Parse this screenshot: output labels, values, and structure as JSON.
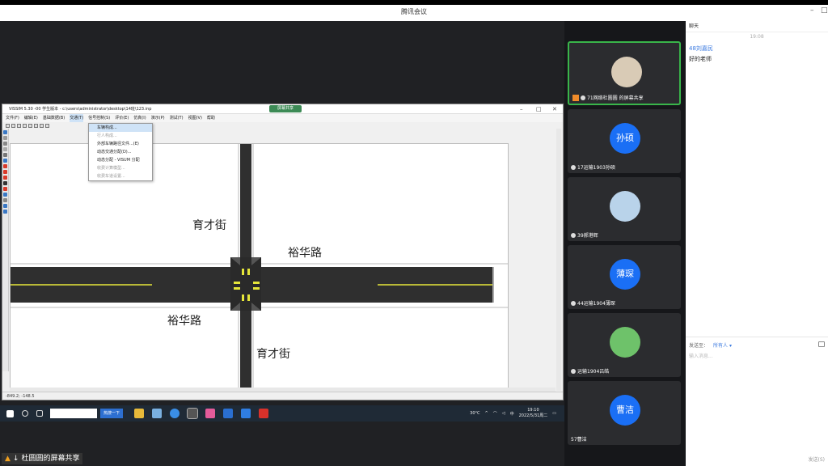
{
  "window": {
    "title": "腾讯会议"
  },
  "share": {
    "vissim_title": "VISSIM 5.30 -00 学生版本 - c:\\users\\administrator\\desktop\\14班\\123.inp",
    "share_tag": "屏幕共享",
    "menu": [
      "文件(F)",
      "编辑(E)",
      "基础数据(B)",
      "交通(T)",
      "信号控制(S)",
      "评价(E)",
      "仿真(I)",
      "演示(P)",
      "测试(T)",
      "视图(V)",
      "帮助"
    ],
    "dropdown": [
      {
        "label": "车辆构成...",
        "state": "highlight"
      },
      {
        "label": "行人构成...",
        "state": "disabled"
      },
      {
        "label": "外部车辆路径文件...(E)",
        "state": "normal"
      },
      {
        "label": "动态交通分配(D)...",
        "state": "normal"
      },
      {
        "label": "动态分配 - VISUM 分配",
        "state": "normal"
      },
      {
        "label": "收费计算模型...",
        "state": "disabled"
      },
      {
        "label": "收费车道设置...",
        "state": "disabled"
      }
    ],
    "roads": {
      "north_label": "育才街",
      "east_label": "裕华路",
      "west_label": "裕华路",
      "south_label": "育才街"
    },
    "status_coords": "-849.2; -148.5",
    "taskbar": {
      "search_button": "热搜一下",
      "weather": "30°C",
      "ime": "中",
      "time": "19:10",
      "date": "2022/5/31周二"
    },
    "sharer_status": "杜圆圆的屏幕共享"
  },
  "participants": [
    {
      "name": "71网络杜圆圆",
      "avatar_text": "",
      "type": "photo",
      "active": true,
      "extra_label": "的屏幕共享"
    },
    {
      "name": "17运输1903孙硕",
      "avatar_text": "孙硕",
      "type": "initials",
      "active": false
    },
    {
      "name": "39郝港辉",
      "avatar_text": "",
      "type": "photo",
      "active": false
    },
    {
      "name": "44运输1904薄琛",
      "avatar_text": "薄琛",
      "type": "initials",
      "active": false
    },
    {
      "name": "运输1904吕皓",
      "avatar_text": "",
      "type": "cartoon",
      "active": false
    },
    {
      "name": "57曹洁",
      "avatar_text": "曹洁",
      "type": "initials",
      "active": false
    }
  ],
  "chat": {
    "header": "聊天",
    "time": "19:08",
    "messages": [
      {
        "sender": "48刘嘉民",
        "text": "好的老师"
      }
    ],
    "send_to_label": "发送至：",
    "send_to_value": "所有人",
    "input_placeholder": "输入消息...",
    "send_label": "发送(S)"
  },
  "colors": {
    "accent_blue": "#1a6ff5",
    "active_green": "#39b54a",
    "road": "#2f2f2f",
    "lane_yellow": "#e6e63a"
  }
}
